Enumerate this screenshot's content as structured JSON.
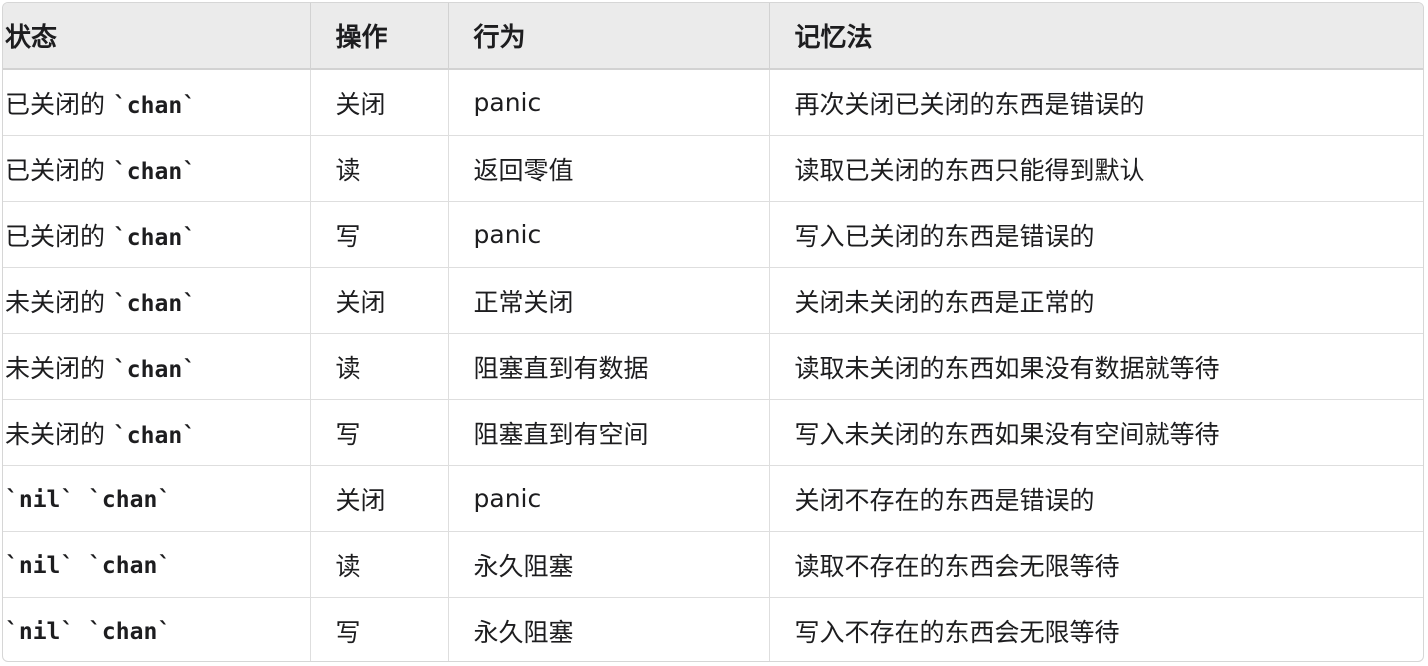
{
  "headers": [
    "状态",
    "操作",
    "行为",
    "记忆法"
  ],
  "rows": [
    {
      "state_prefix": "已关闭的 ",
      "state_code": "`chan`",
      "op": "关闭",
      "behavior": "panic",
      "mnemonic": "再次关闭已关闭的东西是错误的"
    },
    {
      "state_prefix": "已关闭的 ",
      "state_code": "`chan`",
      "op": "读",
      "behavior": "返回零值",
      "mnemonic": "读取已关闭的东西只能得到默认"
    },
    {
      "state_prefix": "已关闭的 ",
      "state_code": "`chan`",
      "op": "写",
      "behavior": "panic",
      "mnemonic": "写入已关闭的东西是错误的"
    },
    {
      "state_prefix": "未关闭的 ",
      "state_code": "`chan`",
      "op": "关闭",
      "behavior": "正常关闭",
      "mnemonic": "关闭未关闭的东西是正常的"
    },
    {
      "state_prefix": "未关闭的 ",
      "state_code": "`chan`",
      "op": "读",
      "behavior": "阻塞直到有数据",
      "mnemonic": "读取未关闭的东西如果没有数据就等待"
    },
    {
      "state_prefix": "未关闭的 ",
      "state_code": "`chan`",
      "op": "写",
      "behavior": "阻塞直到有空间",
      "mnemonic": "写入未关闭的东西如果没有空间就等待"
    },
    {
      "state_prefix": "",
      "state_code": "`nil` `chan`",
      "op": "关闭",
      "behavior": "panic",
      "mnemonic": "关闭不存在的东西是错误的"
    },
    {
      "state_prefix": "",
      "state_code": "`nil` `chan`",
      "op": "读",
      "behavior": "永久阻塞",
      "mnemonic": "读取不存在的东西会无限等待"
    },
    {
      "state_prefix": "",
      "state_code": "`nil` `chan`",
      "op": "写",
      "behavior": "永久阻塞",
      "mnemonic": "写入不存在的东西会无限等待"
    }
  ]
}
